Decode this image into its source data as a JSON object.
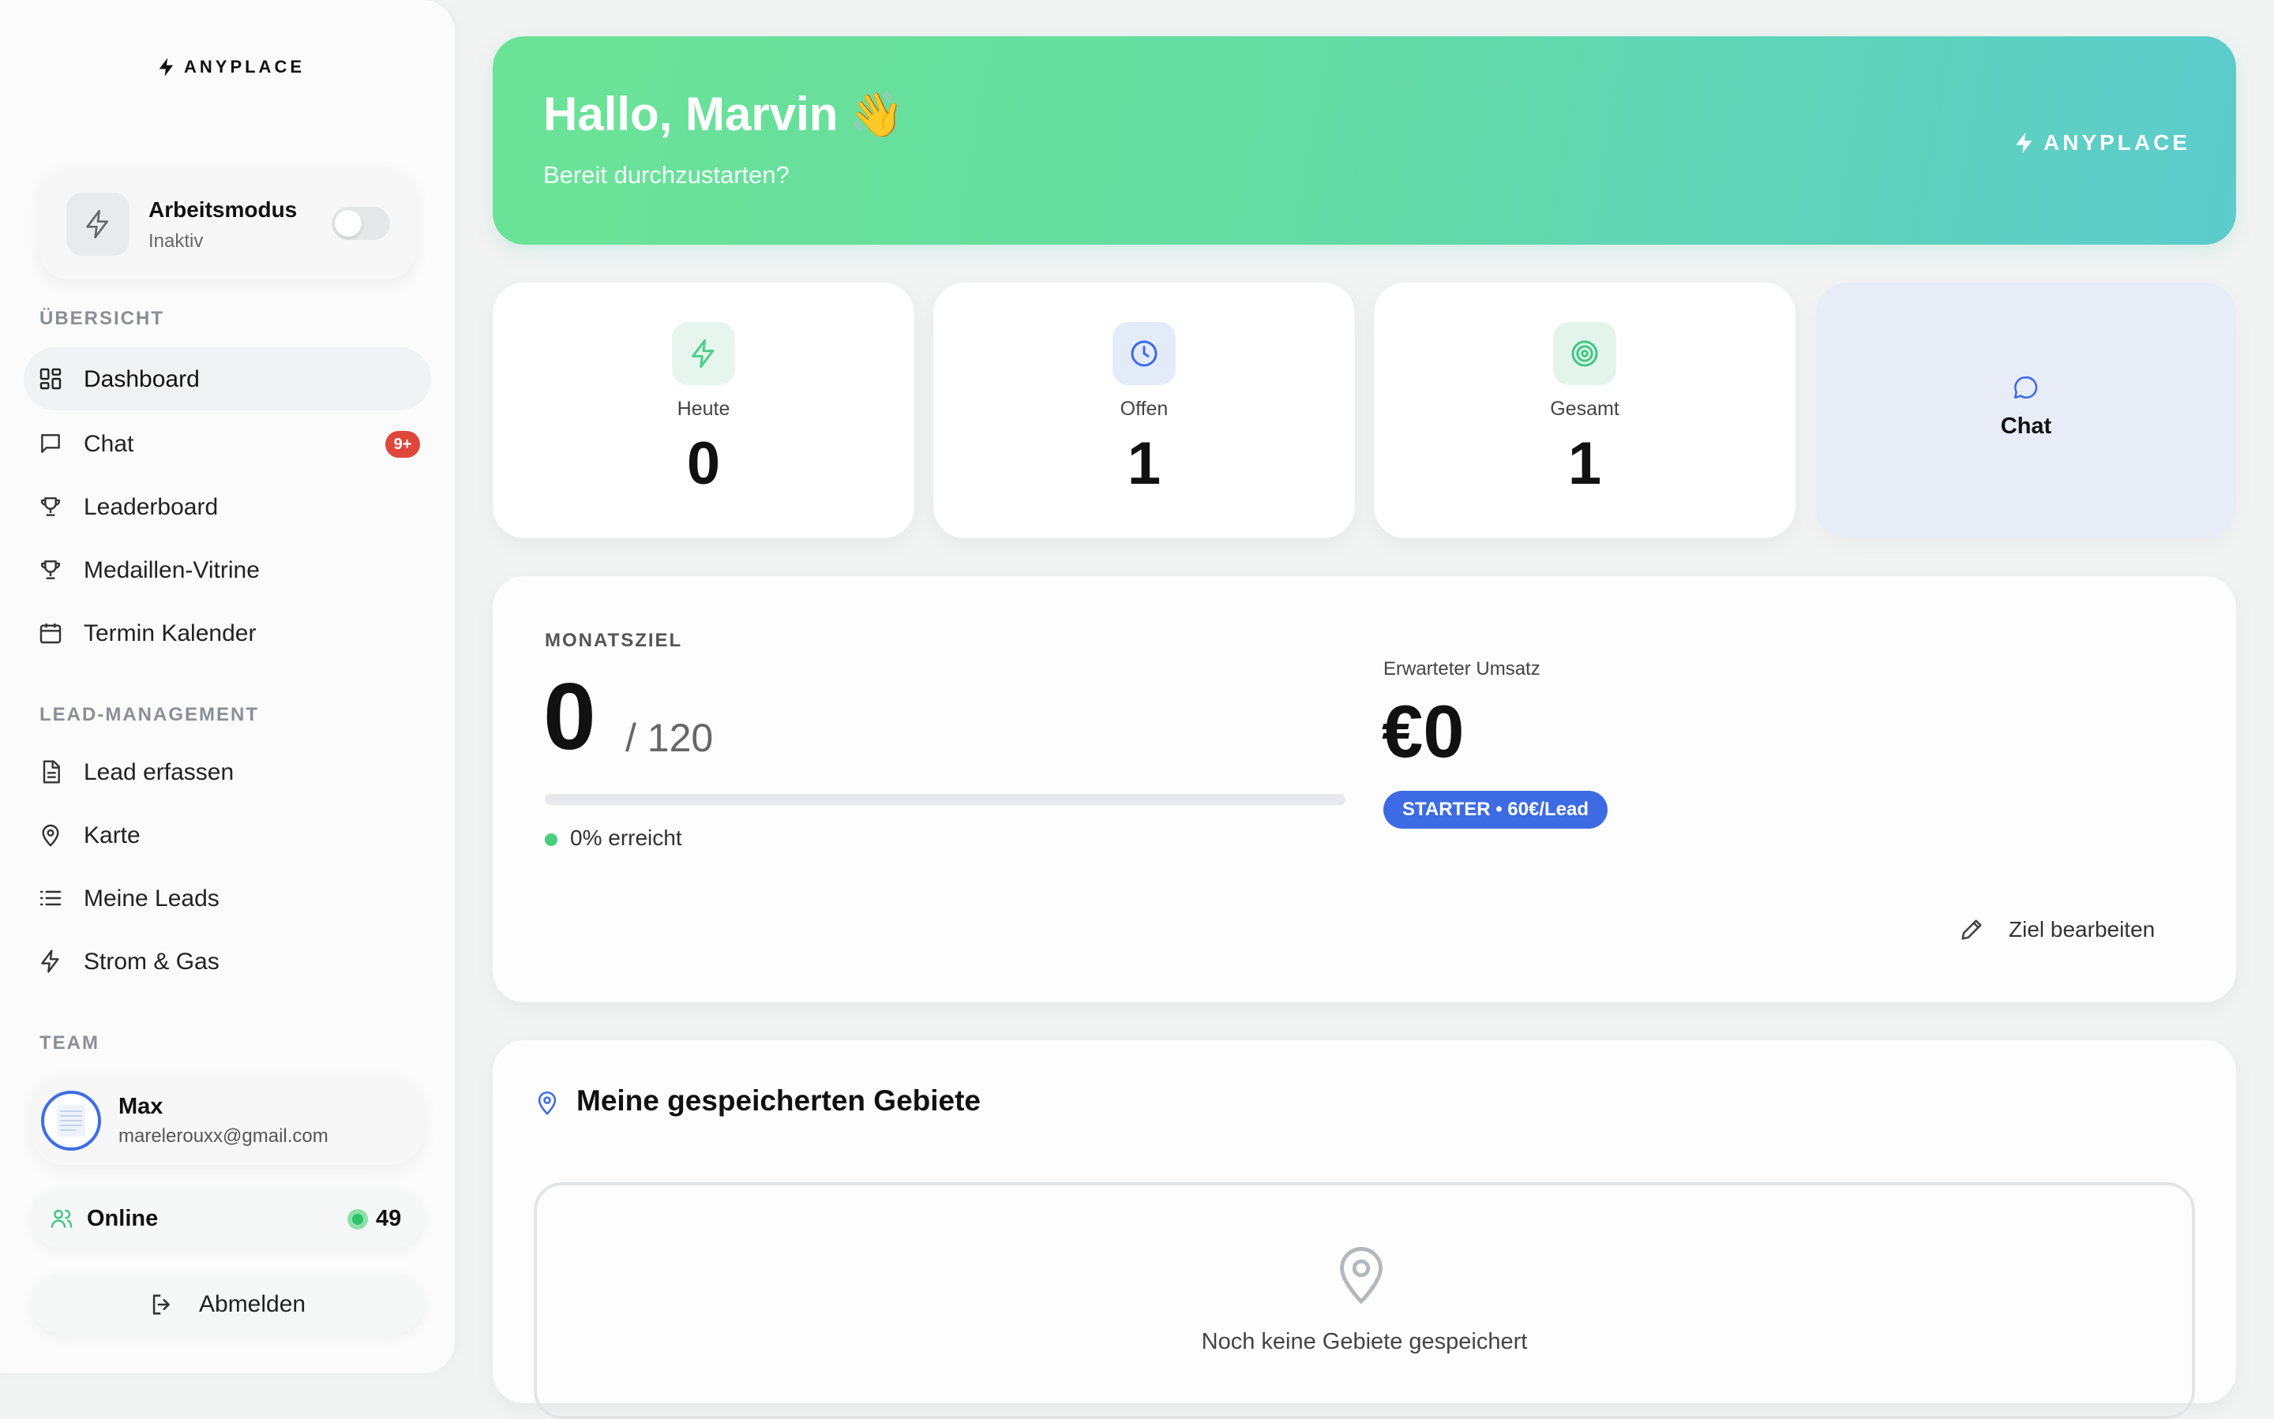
{
  "brand": {
    "name": "ANYPLACE"
  },
  "sidebar": {
    "work_mode": {
      "title": "Arbeitsmodus",
      "status": "Inaktiv",
      "enabled": false
    },
    "sections": {
      "overview": "ÜBERSICHT",
      "lead_management": "LEAD-MANAGEMENT",
      "team": "TEAM"
    },
    "overview_items": [
      {
        "label": "Dashboard",
        "icon": "grid-icon",
        "active": true
      },
      {
        "label": "Chat",
        "icon": "message-icon",
        "badge": "9+"
      },
      {
        "label": "Leaderboard",
        "icon": "trophy-icon"
      },
      {
        "label": "Medaillen-Vitrine",
        "icon": "trophy-icon"
      },
      {
        "label": "Termin Kalender",
        "icon": "calendar-icon"
      }
    ],
    "lead_items": [
      {
        "label": "Lead erfassen",
        "icon": "document-icon"
      },
      {
        "label": "Karte",
        "icon": "map-pin-icon"
      },
      {
        "label": "Meine Leads",
        "icon": "list-icon"
      },
      {
        "label": "Strom & Gas",
        "icon": "bolt-icon"
      }
    ],
    "user": {
      "name": "Max",
      "email": "marelerouxx@gmail.com"
    },
    "online": {
      "label": "Online",
      "count": "49"
    },
    "logout": {
      "label": "Abmelden"
    }
  },
  "hero": {
    "greeting": "Hallo, Marvin",
    "emoji": "👋",
    "subtitle": "Bereit durchzustarten?"
  },
  "stats": [
    {
      "label": "Heute",
      "value": "0",
      "icon": "bolt-icon",
      "color": "#4ecf86"
    },
    {
      "label": "Offen",
      "value": "1",
      "icon": "clock-icon",
      "color": "#3d6be3"
    },
    {
      "label": "Gesamt",
      "value": "1",
      "icon": "target-icon",
      "color": "#3fc783"
    }
  ],
  "chat_card": {
    "label": "Chat"
  },
  "goal": {
    "label": "MONATSZIEL",
    "current": "0",
    "total": "/ 120",
    "progress_percent": 0,
    "reached_text": "0% erreicht",
    "revenue_label": "Erwarteter Umsatz",
    "revenue_value": "€0",
    "plan_badge": "STARTER • 60€/Lead",
    "edit_label": "Ziel bearbeiten"
  },
  "areas": {
    "title": "Meine gespeicherten Gebiete",
    "empty_text": "Noch keine Gebiete gespeichert"
  },
  "colors": {
    "accent_green": "#4ecf86",
    "accent_blue": "#3d6be3",
    "badge_red": "#e0473b"
  }
}
